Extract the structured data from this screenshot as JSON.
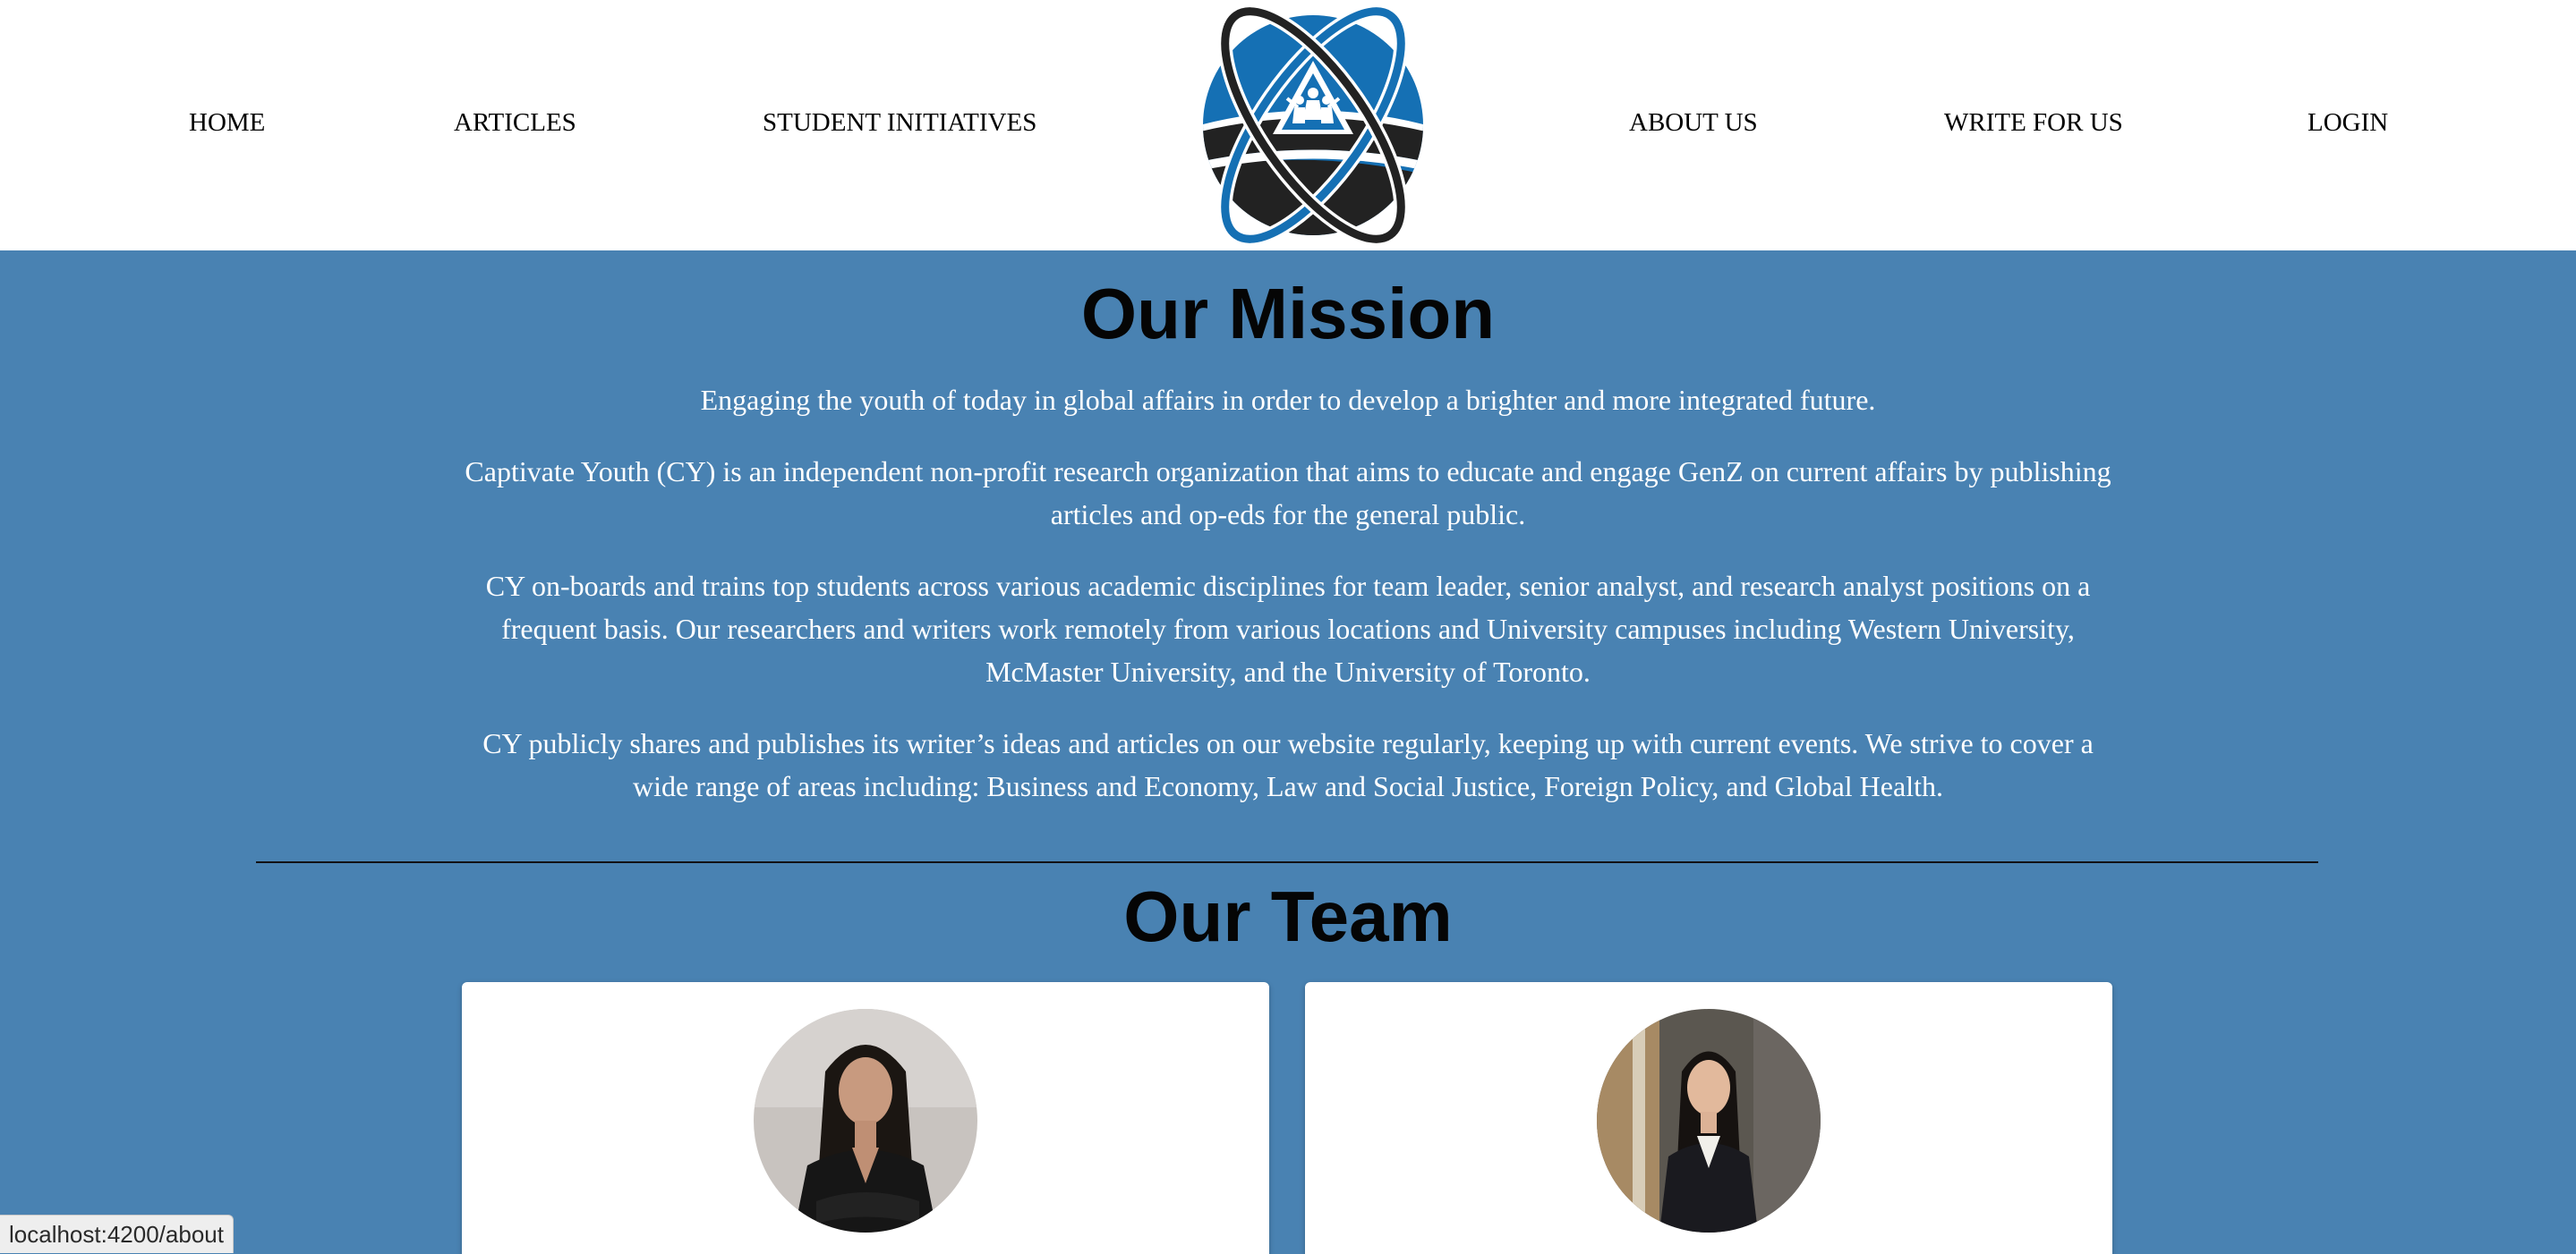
{
  "nav": {
    "home": "HOME",
    "articles": "ARTICLES",
    "student_initiatives": "STUDENT INITIATIVES",
    "about_us": "ABOUT US",
    "write_for_us": "WRITE FOR US",
    "login": "LOGIN"
  },
  "logo": {
    "icon": "captivate-youth-globe-logo",
    "colors": {
      "blue": "#1570b4",
      "dark": "#222222"
    }
  },
  "mission": {
    "title": "Our Mission",
    "tagline": "Engaging the youth of today in global affairs in order to develop a brighter and more integrated future.",
    "paragraphs": [
      "Captivate Youth (CY) is an independent non-profit research organization that aims to educate and engage GenZ on current affairs by publishing articles and op-eds for the general public.",
      "CY on-boards and trains top students across various academic disciplines for team leader, senior analyst, and research analyst positions on a frequent basis. Our researchers and writers work remotely from various locations and University campuses including Western University, McMaster University, and the University of Toronto.",
      "CY publicly shares and publishes its writer’s ideas and articles on our website regularly, keeping up with current events. We strive to cover a wide range of areas including: Business and Economy, Law and Social Justice, Foreign Policy, and Global Health."
    ]
  },
  "team": {
    "title": "Our Team",
    "members": [
      {
        "photo": "team-member-photo"
      },
      {
        "photo": "team-member-photo"
      }
    ]
  },
  "status_bar": {
    "url": "localhost:4200/about"
  },
  "colors": {
    "page_background": "#4982b2",
    "header_background": "#ffffff",
    "heading_text": "#050505",
    "body_text": "#ffffff"
  }
}
